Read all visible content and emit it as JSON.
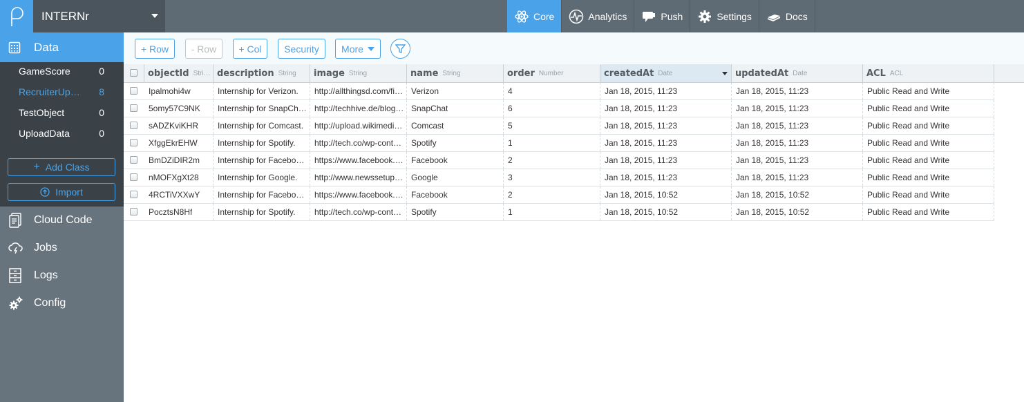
{
  "app": {
    "name": "INTERNr"
  },
  "topnav": [
    {
      "label": "Core",
      "icon": "atom-icon",
      "active": true
    },
    {
      "label": "Analytics",
      "icon": "pulse-icon",
      "active": false
    },
    {
      "label": "Push",
      "icon": "push-icon",
      "active": false
    },
    {
      "label": "Settings",
      "icon": "gear-icon",
      "active": false
    },
    {
      "label": "Docs",
      "icon": "book-icon",
      "active": false
    }
  ],
  "sidebar": {
    "data_label": "Data",
    "classes": [
      {
        "name": "GameScore",
        "count": "0",
        "active": false
      },
      {
        "name": "RecruiterUp…",
        "count": "8",
        "active": true
      },
      {
        "name": "TestObject",
        "count": "0",
        "active": false
      },
      {
        "name": "UploadData",
        "count": "0",
        "active": false
      }
    ],
    "add_class_label": "Add Class",
    "import_label": "Import",
    "nav": [
      {
        "label": "Cloud Code",
        "icon": "document-icon"
      },
      {
        "label": "Jobs",
        "icon": "cloud-icon"
      },
      {
        "label": "Logs",
        "icon": "cabinet-icon"
      },
      {
        "label": "Config",
        "icon": "gears-icon"
      }
    ]
  },
  "toolbar": {
    "add_row": "+ Row",
    "remove_row": "- Row",
    "add_col": "+ Col",
    "security": "Security",
    "more": "More"
  },
  "columns": [
    {
      "name": "objectId",
      "type": "Stri…"
    },
    {
      "name": "description",
      "type": "String"
    },
    {
      "name": "image",
      "type": "String"
    },
    {
      "name": "name",
      "type": "String"
    },
    {
      "name": "order",
      "type": "Number"
    },
    {
      "name": "createdAt",
      "type": "Date"
    },
    {
      "name": "updatedAt",
      "type": "Date"
    },
    {
      "name": "ACL",
      "type": "ACL"
    }
  ],
  "rows": [
    [
      "Ipalmohi4w",
      "Internship for Verizon.",
      "http://allthingsd.com/fi…",
      "Verizon",
      "4",
      "Jan 18, 2015, 11:23",
      "Jan 18, 2015, 11:23",
      "Public Read and Write"
    ],
    [
      "5omy57C9NK",
      "Internship for SnapCh…",
      "http://techhive.de/blog…",
      "SnapChat",
      "6",
      "Jan 18, 2015, 11:23",
      "Jan 18, 2015, 11:23",
      "Public Read and Write"
    ],
    [
      "sADZKviKHR",
      "Internship for Comcast.",
      "http://upload.wikimedi…",
      "Comcast",
      "5",
      "Jan 18, 2015, 11:23",
      "Jan 18, 2015, 11:23",
      "Public Read and Write"
    ],
    [
      "XfggEkrEHW",
      "Internship for Spotify.",
      "http://tech.co/wp-cont…",
      "Spotify",
      "1",
      "Jan 18, 2015, 11:23",
      "Jan 18, 2015, 11:23",
      "Public Read and Write"
    ],
    [
      "BmDZiDIR2m",
      "Internship for Facebo…",
      "https://www.facebook.…",
      "Facebook",
      "2",
      "Jan 18, 2015, 11:23",
      "Jan 18, 2015, 11:23",
      "Public Read and Write"
    ],
    [
      "nMOFXgXt28",
      "Internship for Google.",
      "http://www.newssetup…",
      "Google",
      "3",
      "Jan 18, 2015, 11:23",
      "Jan 18, 2015, 11:23",
      "Public Read and Write"
    ],
    [
      "4RCTiVXXwY",
      "Internship for Facebo…",
      "https://www.facebook.…",
      "Facebook",
      "2",
      "Jan 18, 2015, 10:52",
      "Jan 18, 2015, 10:52",
      "Public Read and Write"
    ],
    [
      "PocztsN8Hf",
      "Internship for Spotify.",
      "http://tech.co/wp-cont…",
      "Spotify",
      "1",
      "Jan 18, 2015, 10:52",
      "Jan 18, 2015, 10:52",
      "Public Read and Write"
    ]
  ],
  "colors": {
    "accent": "#4aa3e8",
    "topbar": "#5e6b74",
    "sidebar_dark": "#3a4248",
    "sidebar": "#68747d"
  }
}
